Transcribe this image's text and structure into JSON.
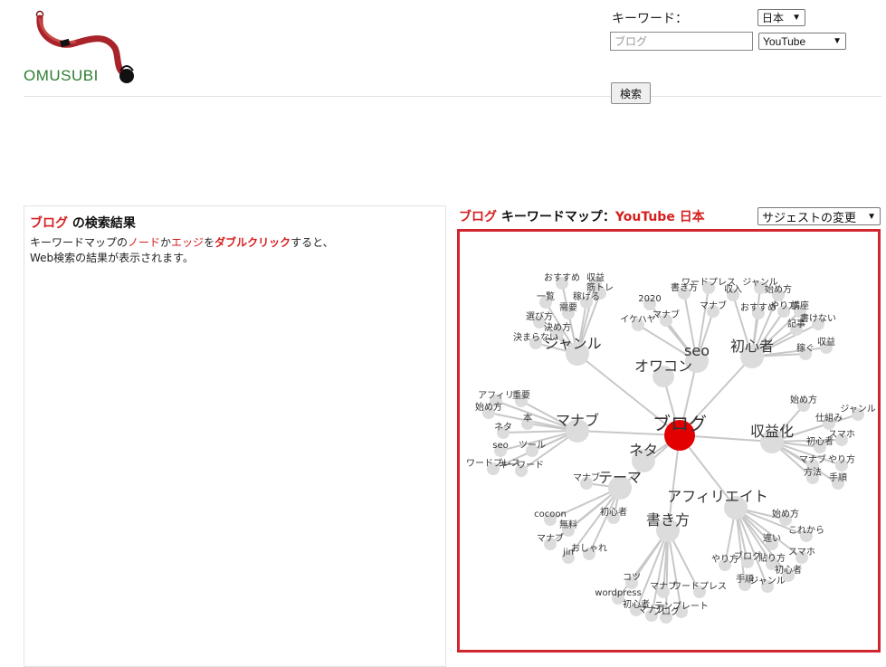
{
  "header": {
    "logo_text": "OMUSUBI",
    "keyword_label": "キーワード：",
    "region_select": "日本",
    "keyword_placeholder": "ブログ",
    "source_select": "YouTube",
    "search_button": "検索"
  },
  "results": {
    "keyword": "ブログ",
    "title_suffix": " の検索結果",
    "desc": {
      "p1": "キーワードマップの",
      "node": "ノード",
      "p2": "か",
      "edge": "エッジ",
      "p3": "を",
      "dblclick": "ダブルクリック",
      "p4": "すると、",
      "line2": "Web検索の結果が表示されます。"
    }
  },
  "map": {
    "keyword": "ブログ",
    "title_mid": " キーワードマップ：",
    "source": "YouTube",
    "region": "日本",
    "suggest_select": "サジェストの変更"
  },
  "graph": {
    "root": "ブログ",
    "hubs": [
      {
        "id": "genre",
        "label": "ジャンル",
        "children": [
          "おすすめ",
          "収益",
          "筋トレ",
          "一覧",
          "稼げる",
          "需要",
          "選び方",
          "決め方",
          "決まらない"
        ]
      },
      {
        "id": "owakon",
        "label": "オワコン",
        "children": []
      },
      {
        "id": "seo",
        "label": "seo",
        "children": [
          "2020",
          "ワードプレス",
          "書き方",
          "マナブ",
          "イケハヤ",
          "マナブ"
        ]
      },
      {
        "id": "shoshinsha",
        "label": "初心者",
        "children": [
          "ジャンル",
          "収入",
          "始め方",
          "おすすめ",
          "やり方",
          "講座",
          "記事",
          "書けない",
          "収益",
          "稼ぐ"
        ]
      },
      {
        "id": "manabu",
        "label": "マナブ",
        "children": [
          "アフィリ",
          "重要",
          "本",
          "始め方",
          "ネタ",
          "seo",
          "ツール",
          "ワードプレス",
          "キーワード"
        ]
      },
      {
        "id": "neta",
        "label": "ネタ",
        "children": []
      },
      {
        "id": "shuekika",
        "label": "収益化",
        "children": [
          "始め方",
          "ジャンル",
          "仕組み",
          "スマホ",
          "初心者",
          "マナブ",
          "やり方",
          "方法",
          "手順"
        ]
      },
      {
        "id": "theme",
        "label": "テーマ",
        "children": [
          "マナブ",
          "cocoon",
          "初心者",
          "無料",
          "マナブ",
          "jin",
          "おしゃれ"
        ]
      },
      {
        "id": "affiliate",
        "label": "アフィリエイト",
        "children": [
          "始め方",
          "これから",
          "違い",
          "スマホ",
          "やり方",
          "ブログ",
          "貼り方",
          "初心者",
          "手順",
          "ジャンル"
        ]
      },
      {
        "id": "kakikata",
        "label": "書き方",
        "children": [
          "コツ",
          "マナブ",
          "ワードプレス",
          "wordpress",
          "初心者",
          "テンプレート",
          "マナブ",
          "ブログ"
        ]
      }
    ]
  }
}
